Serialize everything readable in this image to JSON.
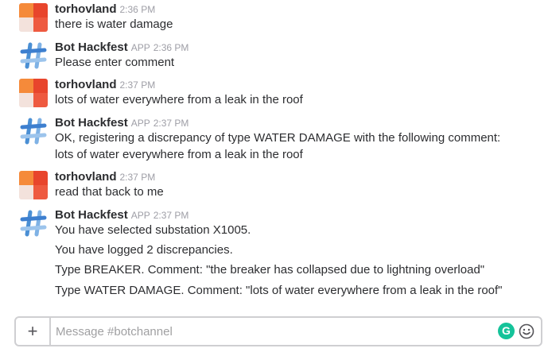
{
  "messages": [
    {
      "author": "torhovland",
      "badge": "",
      "time": "2:36 PM",
      "avatar": "user-avatar",
      "lines": [
        "there is water damage"
      ]
    },
    {
      "author": "Bot Hackfest",
      "badge": "APP",
      "time": "2:36 PM",
      "avatar": "bot-avatar",
      "lines": [
        "Please enter comment"
      ]
    },
    {
      "author": "torhovland",
      "badge": "",
      "time": "2:37 PM",
      "avatar": "user-avatar",
      "lines": [
        "lots of water everywhere from a leak in the roof"
      ]
    },
    {
      "author": "Bot Hackfest",
      "badge": "APP",
      "time": "2:37 PM",
      "avatar": "bot-avatar",
      "lines": [
        "OK, registering a discrepancy of type WATER DAMAGE with the following comment:",
        "lots of water everywhere from a leak in the roof"
      ]
    },
    {
      "author": "torhovland",
      "badge": "",
      "time": "2:37 PM",
      "avatar": "user-avatar",
      "lines": [
        "read that back to me"
      ]
    },
    {
      "author": "Bot Hackfest",
      "badge": "APP",
      "time": "2:37 PM",
      "avatar": "bot-avatar",
      "lines": [
        "You have selected substation X1005.",
        "You have logged 2 discrepancies.",
        "Type BREAKER. Comment: \"the breaker has collapsed due to lightning overload\"",
        "Type WATER DAMAGE. Comment: \"lots of water everywhere from a leak in the roof\""
      ]
    }
  ],
  "composer": {
    "plus_label": "+",
    "placeholder": "Message #botchannel",
    "grammar_icon": "G",
    "emoji_icon": "smiley-icon"
  },
  "colors": {
    "author": "#2c2d30",
    "meta": "#9e9ea6",
    "grammarly": "#15c39a",
    "avatar_orange": "#f58a3a",
    "avatar_red": "#e8452c"
  }
}
